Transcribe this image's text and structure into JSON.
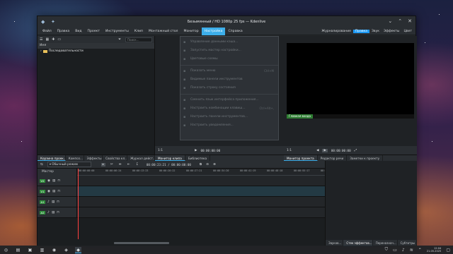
{
  "window": {
    "title": "Безымянный / HD 1080p 25 fps — Kdenlive",
    "app_icon": "kdenlive-icon",
    "pin_icon": "pin-icon"
  },
  "menubar": {
    "items": [
      "Файл",
      "Правка",
      "Вид",
      "Проект",
      "Инструменты",
      "Клип",
      "Монтажный стол",
      "Монитор",
      "Настройка",
      "Справка"
    ],
    "active_item": "Настройка",
    "layouts": [
      "Журналирование",
      "Правка",
      "Звук",
      "Эффекты",
      "Цвет"
    ],
    "selected_layout": "Правка"
  },
  "settings_menu": {
    "items": [
      {
        "label": "Управление данными кэша...",
        "shortcut": ""
      },
      {
        "label": "Запустить мастер настройки...",
        "shortcut": ""
      },
      {
        "label": "Цветовые схемы",
        "shortcut": ""
      },
      {
        "sep": true
      },
      {
        "label": "Показать меню",
        "shortcut": "Ctrl+M"
      },
      {
        "label": "Видимые панели инструментов",
        "shortcut": ""
      },
      {
        "label": "Показать строку состояния",
        "shortcut": ""
      },
      {
        "sep": true
      },
      {
        "label": "Сменить язык интерфейса приложения...",
        "shortcut": ""
      },
      {
        "label": "Настроить комбинации клавиш...",
        "shortcut": "Ctrl+Alt+,"
      },
      {
        "label": "Настроить панели инструментов...",
        "shortcut": ""
      },
      {
        "label": "Настроить уведомления...",
        "shortcut": ""
      }
    ]
  },
  "project_bin": {
    "search_placeholder": "Поиск...",
    "header": "Имя",
    "rows": [
      "Последовательности"
    ]
  },
  "clip_monitor": {
    "zoom": "1:1",
    "timecode": "00:00:00:00",
    "tab": "Монитор клипа",
    "tab2": "Библиотека"
  },
  "project_monitor": {
    "badge": "Главная входа",
    "zoom": "1:1",
    "timecode": "00:00:00:00",
    "tabs": [
      "Монитор проекта",
      "Редактор речи",
      "Заметки к проекту"
    ]
  },
  "left_tabs": [
    "Корзина проек...",
    "Композ...",
    "Эффекты",
    "Свойства кл...",
    "Журнал дейст..."
  ],
  "timeline": {
    "mode": "Обычный режим",
    "timecode": "00:00:23:21 / 00:00:00:00",
    "header_label": "Мастер",
    "ruler": [
      "00:00:00:00",
      "00:00:06:24",
      "00:00:13:23",
      "00:00:20:22",
      "00:00:27:21",
      "00:00:34:20",
      "00:00:41:19",
      "00:00:48:18",
      "00:00:55:17",
      "00:01:02:16"
    ],
    "tracks": [
      {
        "name": "V2",
        "type": "video"
      },
      {
        "name": "V1",
        "type": "video"
      },
      {
        "name": "A1",
        "type": "audio"
      },
      {
        "name": "A2",
        "type": "audio"
      }
    ]
  },
  "right_dock_tabs": [
    "Звуков...",
    "Стек эффектов...",
    "Переназнач...",
    "Субтитры"
  ],
  "taskbar": {
    "time": "12:04",
    "date": "21.05.2025"
  }
}
